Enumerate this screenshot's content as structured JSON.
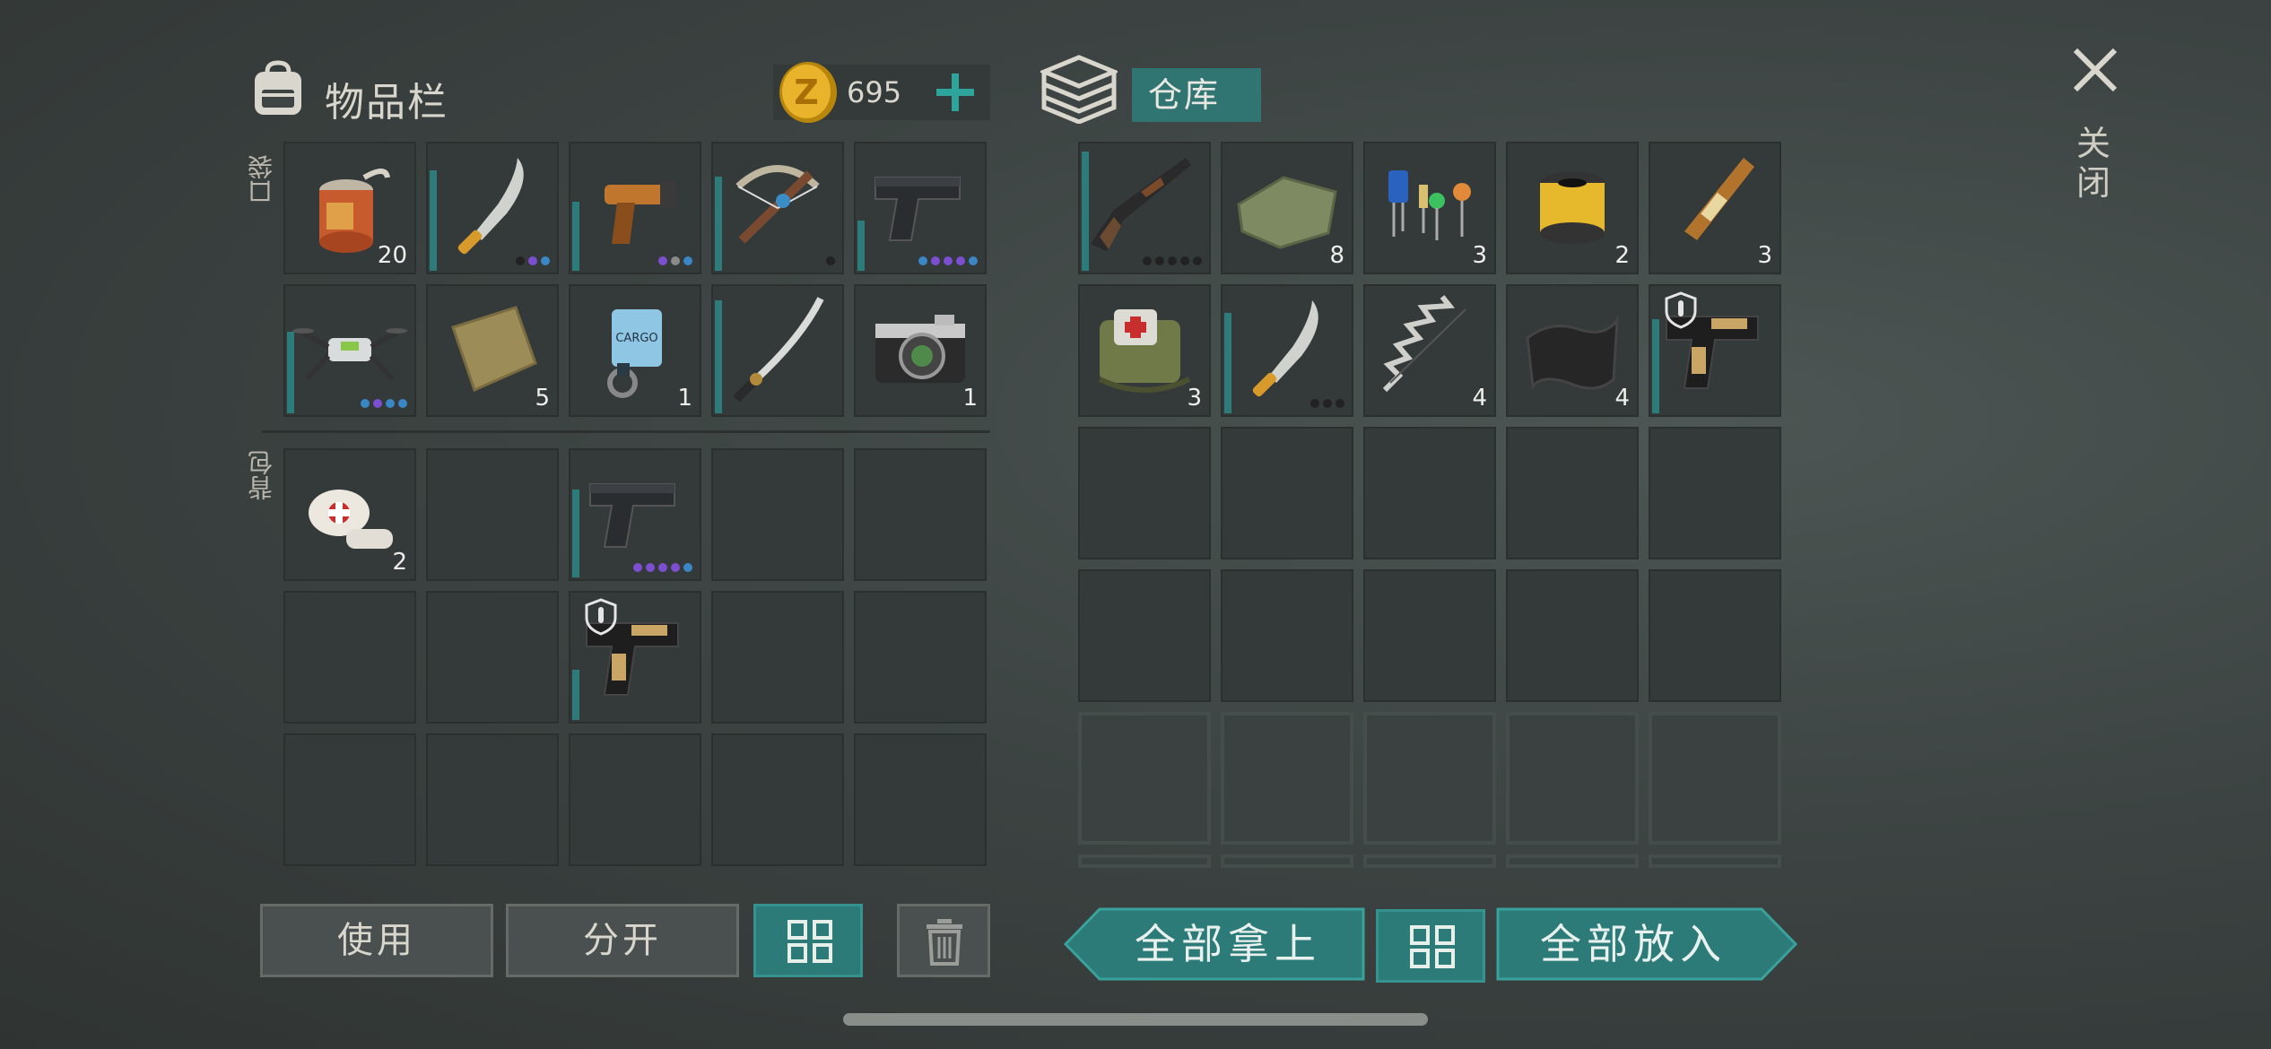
{
  "inventory": {
    "title": "物品栏",
    "currency": {
      "amount": "695",
      "icon": "coin-z-icon",
      "symbol": "Z"
    },
    "pocket_label": "口袋",
    "backpack_label": "背包",
    "pocket_slots": [
      {
        "icon": "canned-food-icon",
        "count": "20"
      },
      {
        "icon": "machete-icon",
        "count": "",
        "durability": 0.8,
        "dots": [
          "#222222",
          "#7b4fcf",
          "#3b86c4"
        ]
      },
      {
        "icon": "flare-gun-icon",
        "count": "",
        "durability": 0.55,
        "dots": [
          "#7b4fcf",
          "#8a8a8a",
          "#3b86c4"
        ]
      },
      {
        "icon": "crossbow-icon",
        "count": "",
        "durability": 0.75,
        "dots": [
          "#222222"
        ]
      },
      {
        "icon": "pistol-icon",
        "count": "",
        "durability": 0.4,
        "dots": [
          "#3b86c4",
          "#7b4fcf",
          "#7b4fcf",
          "#7b4fcf",
          "#3b86c4"
        ]
      },
      {
        "icon": "drone-icon",
        "count": "",
        "durability": 0.65,
        "dots": [
          "#3b86c4",
          "#7b4fcf",
          "#3b86c4",
          "#3b86c4"
        ]
      },
      {
        "icon": "burlap-cloth-icon",
        "count": "5"
      },
      {
        "icon": "cargo-keycard-icon",
        "count": "1"
      },
      {
        "icon": "katana-icon",
        "count": "",
        "durability": 0.9,
        "dots": []
      },
      {
        "icon": "camera-icon",
        "count": "1"
      }
    ],
    "backpack_slots": [
      {
        "icon": "bandage-icon",
        "count": "2"
      },
      {
        "icon": "",
        "count": ""
      },
      {
        "icon": "pistol-icon",
        "count": "",
        "durability": 0.7,
        "dots": [
          "#7b4fcf",
          "#7b4fcf",
          "#7b4fcf",
          "#7b4fcf",
          "#3b86c4"
        ]
      },
      {
        "icon": "",
        "count": ""
      },
      {
        "icon": "",
        "count": ""
      },
      {
        "icon": "",
        "count": ""
      },
      {
        "icon": "",
        "count": ""
      },
      {
        "icon": "desert-eagle-icon",
        "count": "",
        "durability": 0.4,
        "dots": [],
        "shield": true
      },
      {
        "icon": "",
        "count": ""
      },
      {
        "icon": "",
        "count": ""
      },
      {
        "icon": "",
        "count": ""
      },
      {
        "icon": "",
        "count": ""
      },
      {
        "icon": "",
        "count": ""
      },
      {
        "icon": "",
        "count": ""
      },
      {
        "icon": "",
        "count": ""
      }
    ],
    "buttons": {
      "use": "使用",
      "split": "分开",
      "sort_icon": "grid-sort-icon",
      "delete_icon": "trash-icon"
    }
  },
  "storage": {
    "title": "仓库",
    "slots": [
      {
        "icon": "shotgun-icon",
        "count": "",
        "durability": 0.95,
        "dots": [
          "#222222",
          "#222222",
          "#222222",
          "#222222",
          "#222222"
        ]
      },
      {
        "icon": "cloth-icon",
        "count": "8"
      },
      {
        "icon": "electronic-components-icon",
        "count": "3"
      },
      {
        "icon": "oil-filter-icon",
        "count": "2"
      },
      {
        "icon": "ampoule-icon",
        "count": "3"
      },
      {
        "icon": "medkit-bag-icon",
        "count": "3"
      },
      {
        "icon": "machete-icon",
        "count": "",
        "durability": 0.8,
        "dots": [
          "#222222",
          "#222222",
          "#222222"
        ]
      },
      {
        "icon": "spring-icon",
        "count": "4"
      },
      {
        "icon": "carbon-fiber-icon",
        "count": "4"
      },
      {
        "icon": "desert-eagle-icon",
        "count": "",
        "durability": 0.75,
        "dots": [],
        "shield": true
      }
    ],
    "buttons": {
      "take_all": "全部拿上",
      "sort_icon": "grid-sort-icon",
      "put_all": "全部放入"
    }
  },
  "close": {
    "label": "关闭",
    "icon": "close-icon"
  },
  "colors": {
    "accent": "#2c7b79",
    "slot": "#34393a",
    "purple": "#7b4fcf",
    "blue": "#3b86c4"
  }
}
